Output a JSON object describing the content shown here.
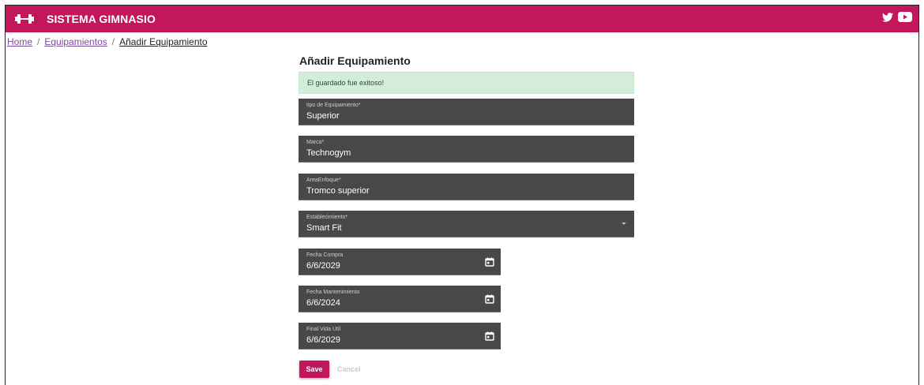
{
  "header": {
    "brand": "SISTEMA GIMNASIO",
    "color": "#c2185b",
    "logo_icon": "dumbbell-icon",
    "social_icons": [
      "twitter-icon",
      "youtube-icon"
    ]
  },
  "breadcrumb": {
    "items": [
      "Home",
      "Equipamientos"
    ],
    "current": "Añadir Equipamiento",
    "separator": "/"
  },
  "form": {
    "title": "Añadir Equipamiento",
    "alert": "El guardado fue exitoso!",
    "fields": [
      {
        "label": "tipo de Equipamiento*",
        "value": "Superior"
      },
      {
        "label": "Marca*",
        "value": "Technogym"
      },
      {
        "label": "AreaEnfoque*",
        "value": "Tromco superior"
      },
      {
        "label": "Establecimiento*",
        "value": "Smart Fit"
      },
      {
        "label": "Fecha Compra",
        "value": "6/6/2029"
      },
      {
        "label": "Fecha Mantenimiento",
        "value": "6/6/2024"
      },
      {
        "label": "Final Vida Util",
        "value": "6/6/2029"
      }
    ],
    "save_label": "Save",
    "cancel_label": "Cancel"
  }
}
